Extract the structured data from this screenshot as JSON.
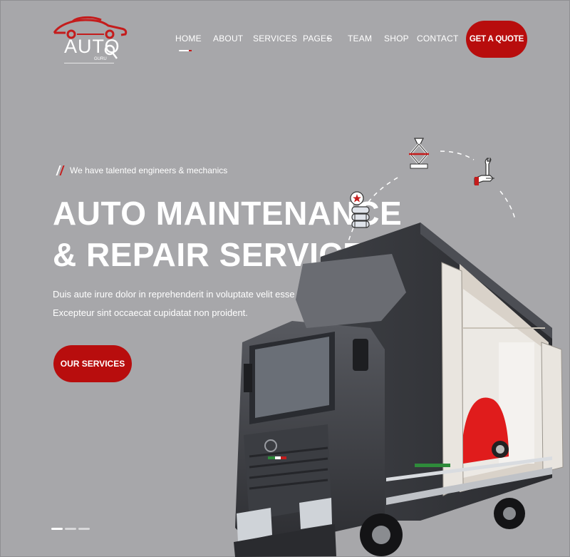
{
  "logo": {
    "text": "AUTO",
    "sub": "GURU"
  },
  "nav": {
    "items": [
      {
        "label": "HOME"
      },
      {
        "label": "ABOUT"
      },
      {
        "label": "SERVICES"
      },
      {
        "label": "PAGES"
      },
      {
        "label": "TEAM"
      },
      {
        "label": "SHOP"
      },
      {
        "label": "CONTACT"
      }
    ],
    "cta": "GET A QUOTE"
  },
  "hero": {
    "tagline": "We have talented engineers & mechanics",
    "title_line1": "AUTO MAINTENANCE",
    "title_line2": "& REPAIR SERVICE",
    "desc_line1": "Duis aute irure dolor in reprehenderit in voluptate velit esse",
    "desc_line2": "Excepteur sint occaecat cupidatat non proident.",
    "button": "OUR SERVICES"
  },
  "colors": {
    "accent": "#b80d0d",
    "background": "#a7a7aa",
    "text": "#ffffff"
  },
  "icons": [
    "car-jack-icon",
    "tire-stack-icon",
    "wrench-hand-icon"
  ],
  "slider": {
    "count": 3,
    "active": 1
  }
}
